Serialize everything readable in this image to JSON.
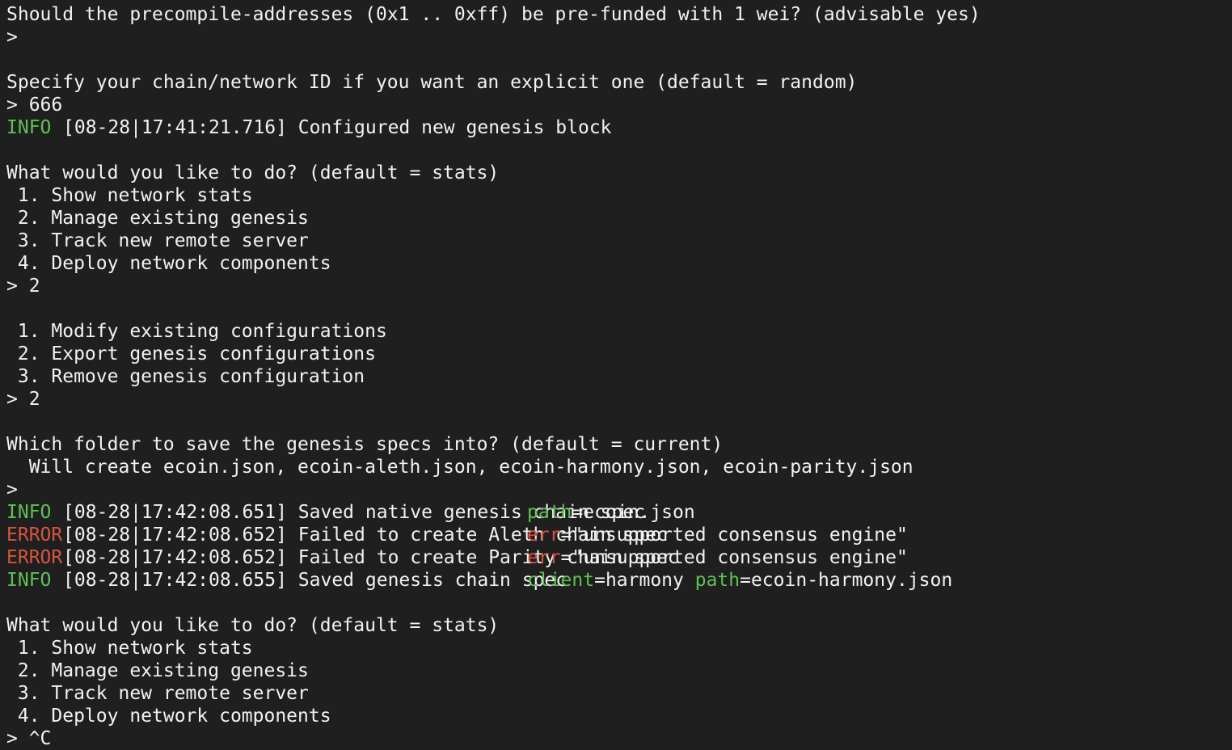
{
  "lines": {
    "l0": "Should the precompile-addresses (0x1 .. 0xff) be pre-funded with 1 wei? (advisable yes)",
    "l1": ">",
    "l2": "",
    "l3": "Specify your chain/network ID if you want an explicit one (default = random)",
    "l4": "> 666",
    "l5_level": "INFO",
    "l5_rest": "[08-28|17:41:21.716] Configured new genesis block",
    "l6": "",
    "l7": "What would you like to do? (default = stats)",
    "l8": " 1. Show network stats",
    "l9": " 2. Manage existing genesis",
    "l10": " 3. Track new remote server",
    "l11": " 4. Deploy network components",
    "l12": "> 2",
    "l13": "",
    "l14": " 1. Modify existing configurations",
    "l15": " 2. Export genesis configurations",
    "l16": " 3. Remove genesis configuration",
    "l17": "> 2",
    "l18": "",
    "l19": "Which folder to save the genesis specs into? (default = current)",
    "l20": "  Will create ecoin.json, ecoin-aleth.json, ecoin-harmony.json, ecoin-parity.json",
    "l21": ">",
    "log1": {
      "level": "INFO",
      "msg": "[08-28|17:42:08.651] Saved native genesis chain spec",
      "k1": "path",
      "v1": "=ecoin.json"
    },
    "log2": {
      "level": "ERROR",
      "msg": "[08-28|17:42:08.652] Failed to create Aleth chain spec",
      "k1": "err",
      "v1": "=\"unsupported consensus engine\""
    },
    "log3": {
      "level": "ERROR",
      "msg": "[08-28|17:42:08.652] Failed to create Parity chain spec",
      "k1": "err",
      "v1": "=\"unsupported consensus engine\""
    },
    "log4": {
      "level": "INFO",
      "msg": "[08-28|17:42:08.655] Saved genesis chain spec",
      "k1": "client",
      "v1": "=harmony ",
      "k2": "path",
      "v2": "=ecoin-harmony.json"
    },
    "l26": "",
    "l27": "What would you like to do? (default = stats)",
    "l28": " 1. Show network stats",
    "l29": " 2. Manage existing genesis",
    "l30": " 3. Track new remote server",
    "l31": " 4. Deploy network components",
    "l32": "> ^C"
  },
  "colors": {
    "background": "#1f1f1f",
    "text": "#f2f2f2",
    "info": "#5fc054",
    "error": "#d7553f"
  }
}
